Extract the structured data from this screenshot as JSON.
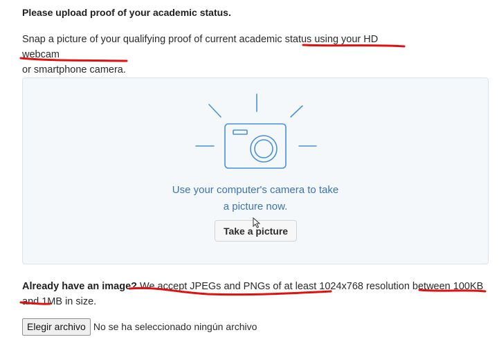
{
  "heading": "Please upload proof of your academic status.",
  "intro": {
    "part1": "Snap a picture of your qualifying proof of current academic status ",
    "part2": "using your HD webcam",
    "part3": "or smartphone camera."
  },
  "camera_panel": {
    "icon": "camera-icon",
    "prompt_line1": "Use your computer's camera to take",
    "prompt_line2": "a picture now.",
    "take_picture_label": "Take a picture"
  },
  "existing_image": {
    "lead": "Already have an image?",
    "text": " We accept JPEGs and PNGs of at least 1024x768 resolution between 100KB and 1MB in size."
  },
  "file_input": {
    "button_label": "Elegir archivo",
    "status": "No se ha seleccionado ningún archivo"
  },
  "colors": {
    "accent": "#3b73b6",
    "annotation": "#e01010",
    "panel_bg": "#f5f8fb"
  }
}
